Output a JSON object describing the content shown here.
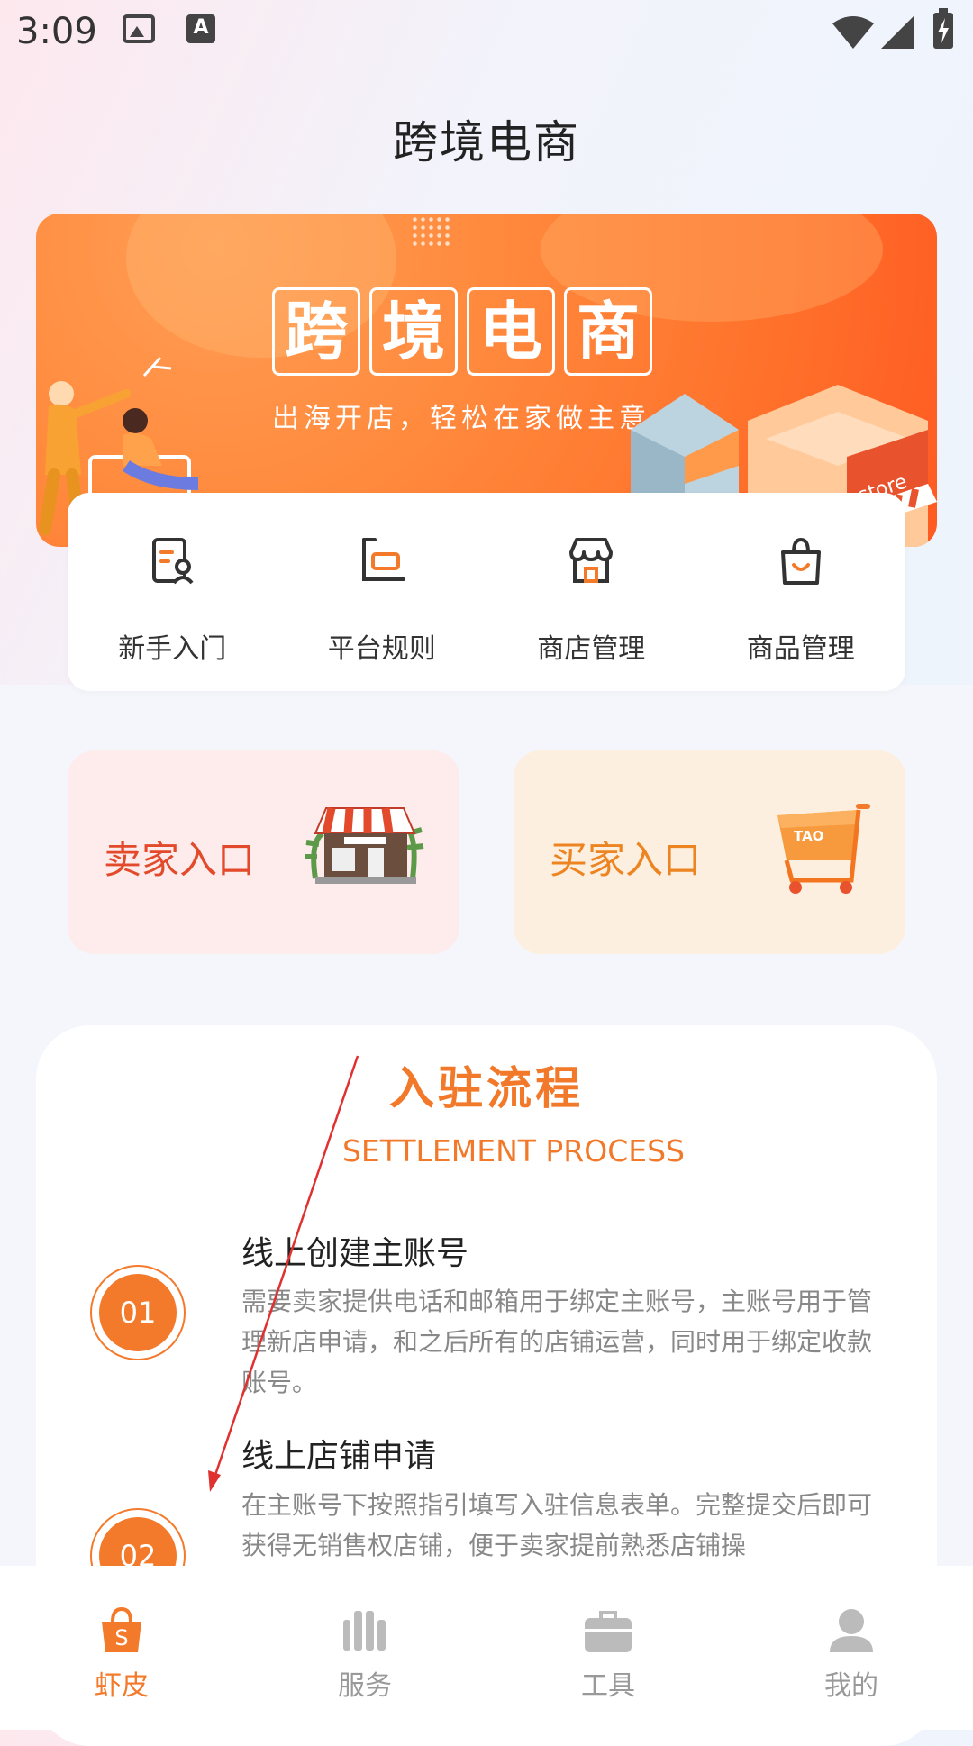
{
  "status_bar": {
    "time": "3:09"
  },
  "header": {
    "title": "跨境电商"
  },
  "banner": {
    "title_chars": [
      "跨",
      "境",
      "电",
      "商"
    ],
    "slogan": "出海开店，轻松在家做主意",
    "store_sign": "store"
  },
  "quick_menu": {
    "items": [
      {
        "label": "新手入门",
        "icon": "beginner-guide-icon"
      },
      {
        "label": "平台规则",
        "icon": "platform-rules-icon"
      },
      {
        "label": "商店管理",
        "icon": "store-management-icon"
      },
      {
        "label": "商品管理",
        "icon": "product-management-icon"
      }
    ]
  },
  "entries": {
    "seller": {
      "label": "卖家入口"
    },
    "buyer": {
      "label": "买家入口",
      "cart_text": "TAO"
    }
  },
  "settlement": {
    "title": "入驻流程",
    "subtitle": "SETTLEMENT PROCESS",
    "steps": [
      {
        "num": "01",
        "title": "线上创建主账号",
        "desc": "需要卖家提供电话和邮箱用于绑定主账号，主账号用于管理新店申请，和之后所有的店铺运营，同时用于绑定收款账号。"
      },
      {
        "num": "02",
        "title": "线上店铺申请",
        "desc": "在主账号下按照指引填写入驻信息表单。完整提交后即可获得无销售权店铺，便于卖家提前熟悉店铺操"
      }
    ]
  },
  "bottom_nav": {
    "items": [
      {
        "label": "虾皮",
        "icon": "shopee-bag-icon",
        "active": true
      },
      {
        "label": "服务",
        "icon": "service-icon",
        "active": false
      },
      {
        "label": "工具",
        "icon": "toolbox-icon",
        "active": false
      },
      {
        "label": "我的",
        "icon": "profile-icon",
        "active": false
      }
    ]
  },
  "colors": {
    "accent": "#f47a2b",
    "seller_red": "#e24a2b",
    "buyer_orange": "#ec8421",
    "annotation": "#e03030"
  }
}
